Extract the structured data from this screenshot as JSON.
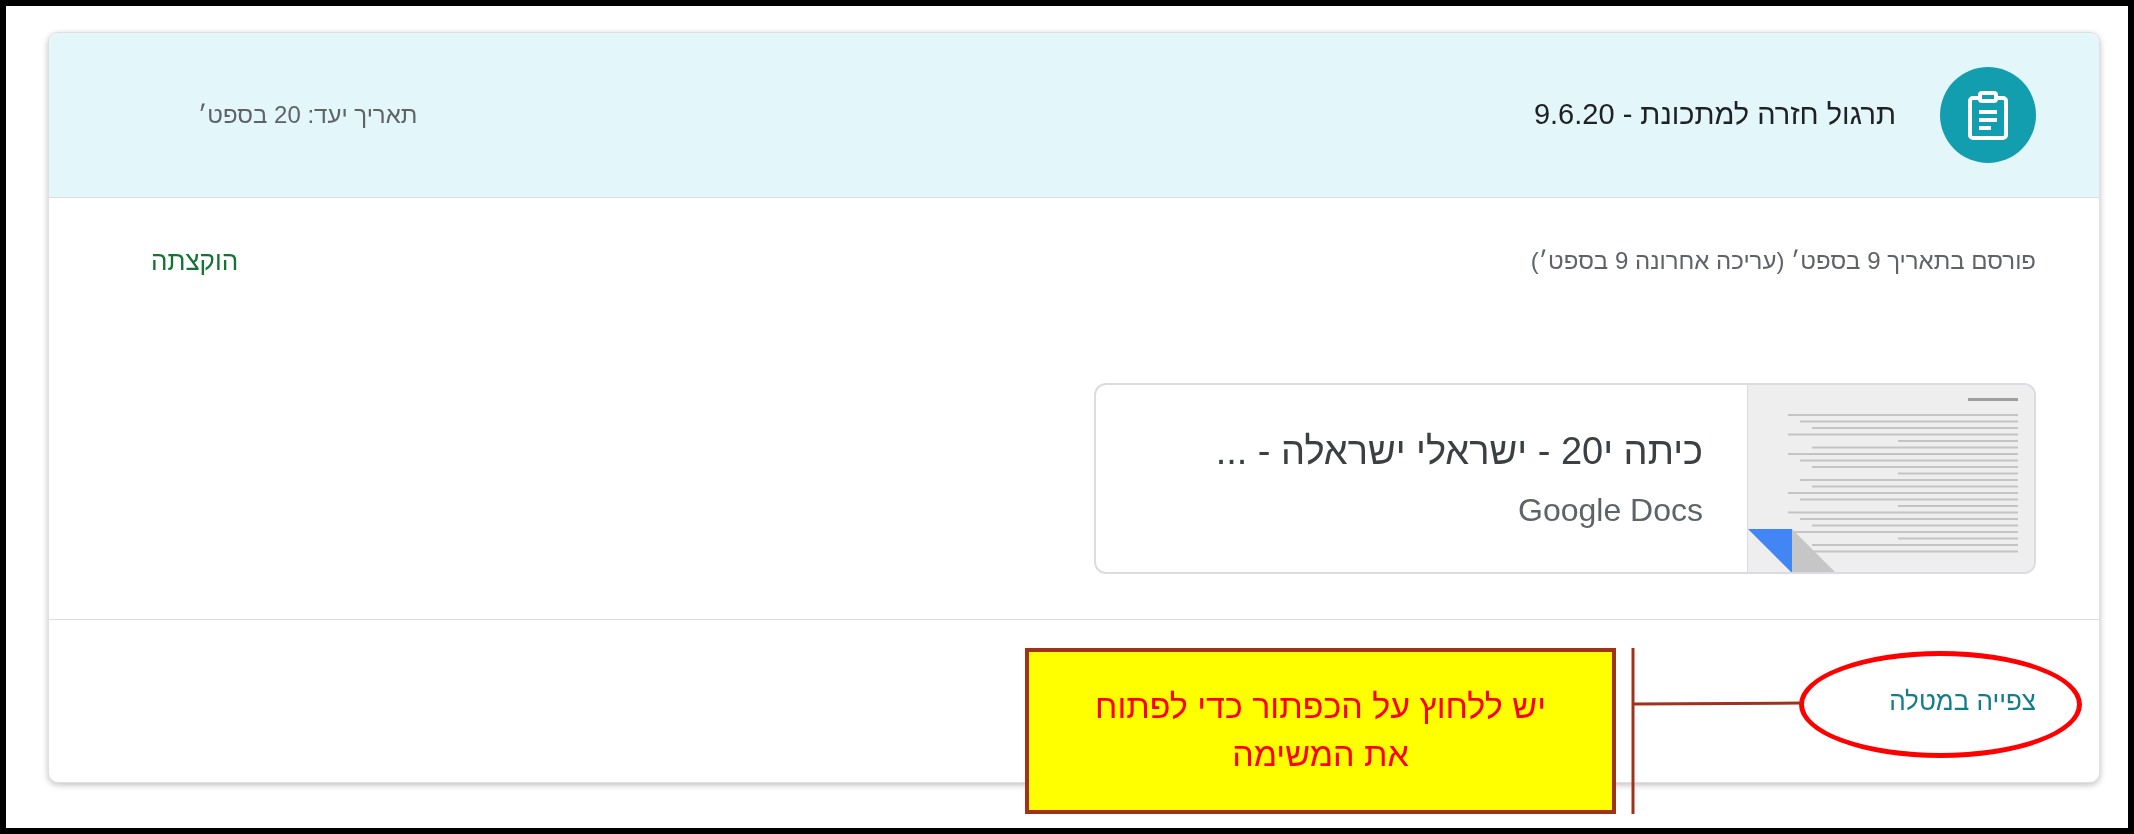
{
  "assignment": {
    "title": "תרגול חזרה למתכונת - 9.6.20",
    "due": "תאריך יעד: 20 בספט׳",
    "posted": "פורסם בתאריך 9 בספט׳ (עריכה אחרונה 9 בספט׳)",
    "status": "הוקצתה",
    "attachment": {
      "title": "כיתה י20 - ישראלי ישראלה - ...",
      "type": "Google Docs"
    },
    "view_link": "צפייה במטלה"
  },
  "annotation": {
    "text": "יש ללחוץ על הכפתור כדי לפתוח את המשימה"
  }
}
